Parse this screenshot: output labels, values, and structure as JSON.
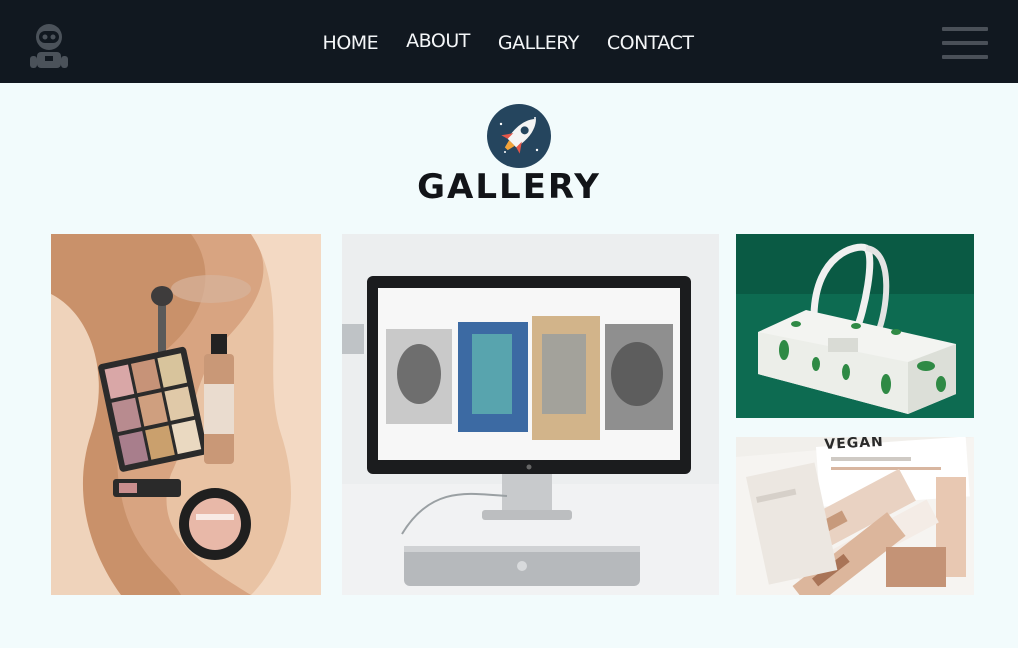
{
  "header": {
    "logo_icon": "astronaut-icon",
    "nav": [
      {
        "label": "HOME"
      },
      {
        "label": "ABOUT"
      },
      {
        "label": "GALLERY"
      },
      {
        "label": "CONTACT"
      }
    ],
    "menu_icon": "hamburger-menu-icon"
  },
  "hero": {
    "badge_icon": "rocket-icon",
    "title": "GALLERY"
  },
  "gallery": {
    "tiles": [
      {
        "subject": "cosmetics-flatlay",
        "caption": ""
      },
      {
        "subject": "desktop-monitor-workspace",
        "caption": ""
      },
      {
        "subject": "eco-gift-bag",
        "caption": ""
      },
      {
        "subject": "vegan-packaging",
        "caption": "VEGAN"
      }
    ]
  },
  "colors": {
    "header_bg": "#111820",
    "page_bg": "#f2fbfc",
    "badge_bg": "#25455e",
    "title_text": "#121418"
  }
}
